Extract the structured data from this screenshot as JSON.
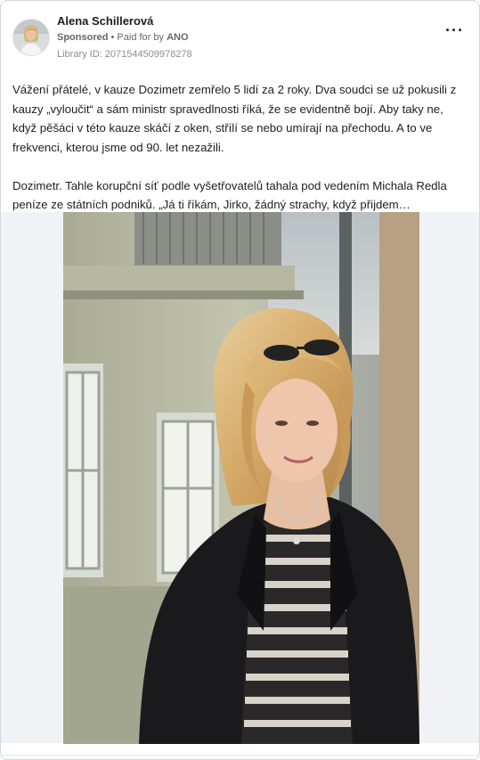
{
  "post": {
    "author": "Alena Schillerová",
    "sponsored": "Sponsored",
    "paid_for_prefix": "• Paid for by",
    "paid_for_by": "ANO",
    "library_id": "Library ID: 2071544509978278",
    "more_icon": "···",
    "paragraphs": [
      "Vážení přátelé, v kauze Dozimetr zemřelo 5 lidí za 2 roky. Dva soudci se už pokusili z kauzy „vyloučit“ a sám ministr spravedlnosti říká, že se evidentně bojí. Aby taky ne, když pěšáci v této kauze skáčí z oken, střílí se nebo umírají na přechodu. A to ve frekvenci, kterou jsme od 90. let nezažili.",
      "Dozimetr. Tahle korupční síť podle vyšetřovatelů tahala pod vedením Michala Redla peníze ze státních podniků. „Já ti říkám, Jirko, žádný strachy, když přijdem…"
    ]
  },
  "colors": {
    "text": "#1c1e21",
    "secondary": "#65676b",
    "muted": "#8a8d91",
    "media_background": "#f0f2f5"
  },
  "icons": {
    "avatar": "profile-photo",
    "more": "more-options-icon"
  }
}
